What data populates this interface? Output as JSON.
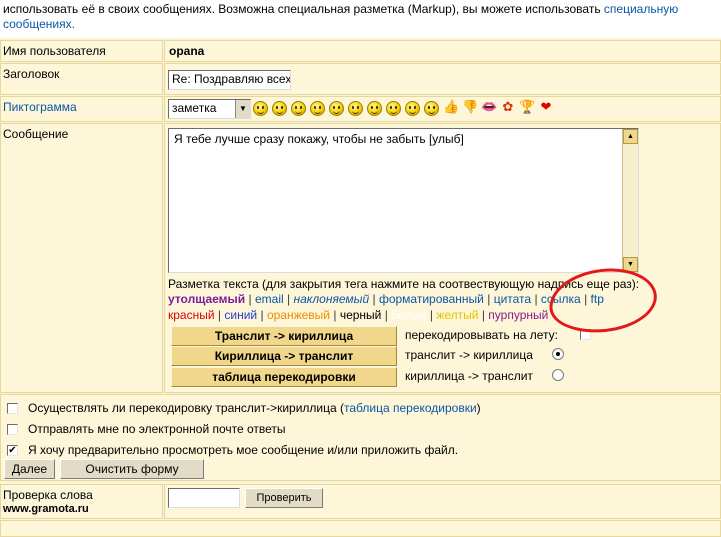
{
  "intro": {
    "line1_text": "использовать её в своих сообщениях. Возможна специальная разметка (Markup), вы можете использовать ",
    "line1_link": "специальную",
    "line2_link": "сообщениях."
  },
  "form": {
    "username_label": "Имя пользователя",
    "username_value": "opana",
    "title_label": "Заголовок",
    "title_value": "Re: Поздравляю всех",
    "icon_label": "Пиктограмма",
    "icon_select_value": "заметка",
    "icons": [
      "smile",
      "smile",
      "smile",
      "smile",
      "smile",
      "smile",
      "smile",
      "smile",
      "smile",
      "smile",
      "thumbs-up",
      "thumbs-down",
      "lips",
      "flower",
      "trophy",
      "heart"
    ],
    "message_label": "Сообщение",
    "message_text": "Я тебе лучше сразу покажу, чтобы не забыть [улыб]"
  },
  "markup": {
    "hint": "Разметка текста (для закрытия тега нажмите на соотвествующую надпись еще раз):",
    "bold": "утолщаемый",
    "email": "email",
    "italic": "наклоняемый",
    "formatted": "форматированный",
    "quote": "цитата",
    "link": "ссылка",
    "ftp": "ftp",
    "red": "красный",
    "blue": "синий",
    "orange": "оранжевый",
    "black": "черный",
    "white": "белый",
    "yellow": "желтый",
    "purple": "пурпурный"
  },
  "translit": {
    "btn_translit_to_cyr": "Транслит -> кириллица",
    "btn_cyr_to_translit": "Кириллица -> транслит",
    "btn_table": "таблица перекодировки",
    "on_the_fly": "перекодировывать на лету:",
    "mode1": "транслит -> кириллица",
    "mode2": "кириллица -> транслит"
  },
  "options": {
    "opt1_text": "Осуществлять ли перекодировку транслит->кириллица (",
    "opt1_link": "таблица перекодировки",
    "opt1_end": ")",
    "opt2_text": "Отправлять мне по электронной почте ответы",
    "opt3_text": "Я хочу предварительно просмотреть мое сообщение и/или приложить файл.",
    "opt3_checked": "✔"
  },
  "actions": {
    "next": "Далее",
    "clear": "Очистить форму"
  },
  "spell": {
    "label": "Проверка слова",
    "site": "www.gramota.ru",
    "check": "Проверить"
  },
  "colors": {
    "page_bg": "#fbf5d7",
    "link": "#0a56a6",
    "annotation": "#e31919"
  }
}
